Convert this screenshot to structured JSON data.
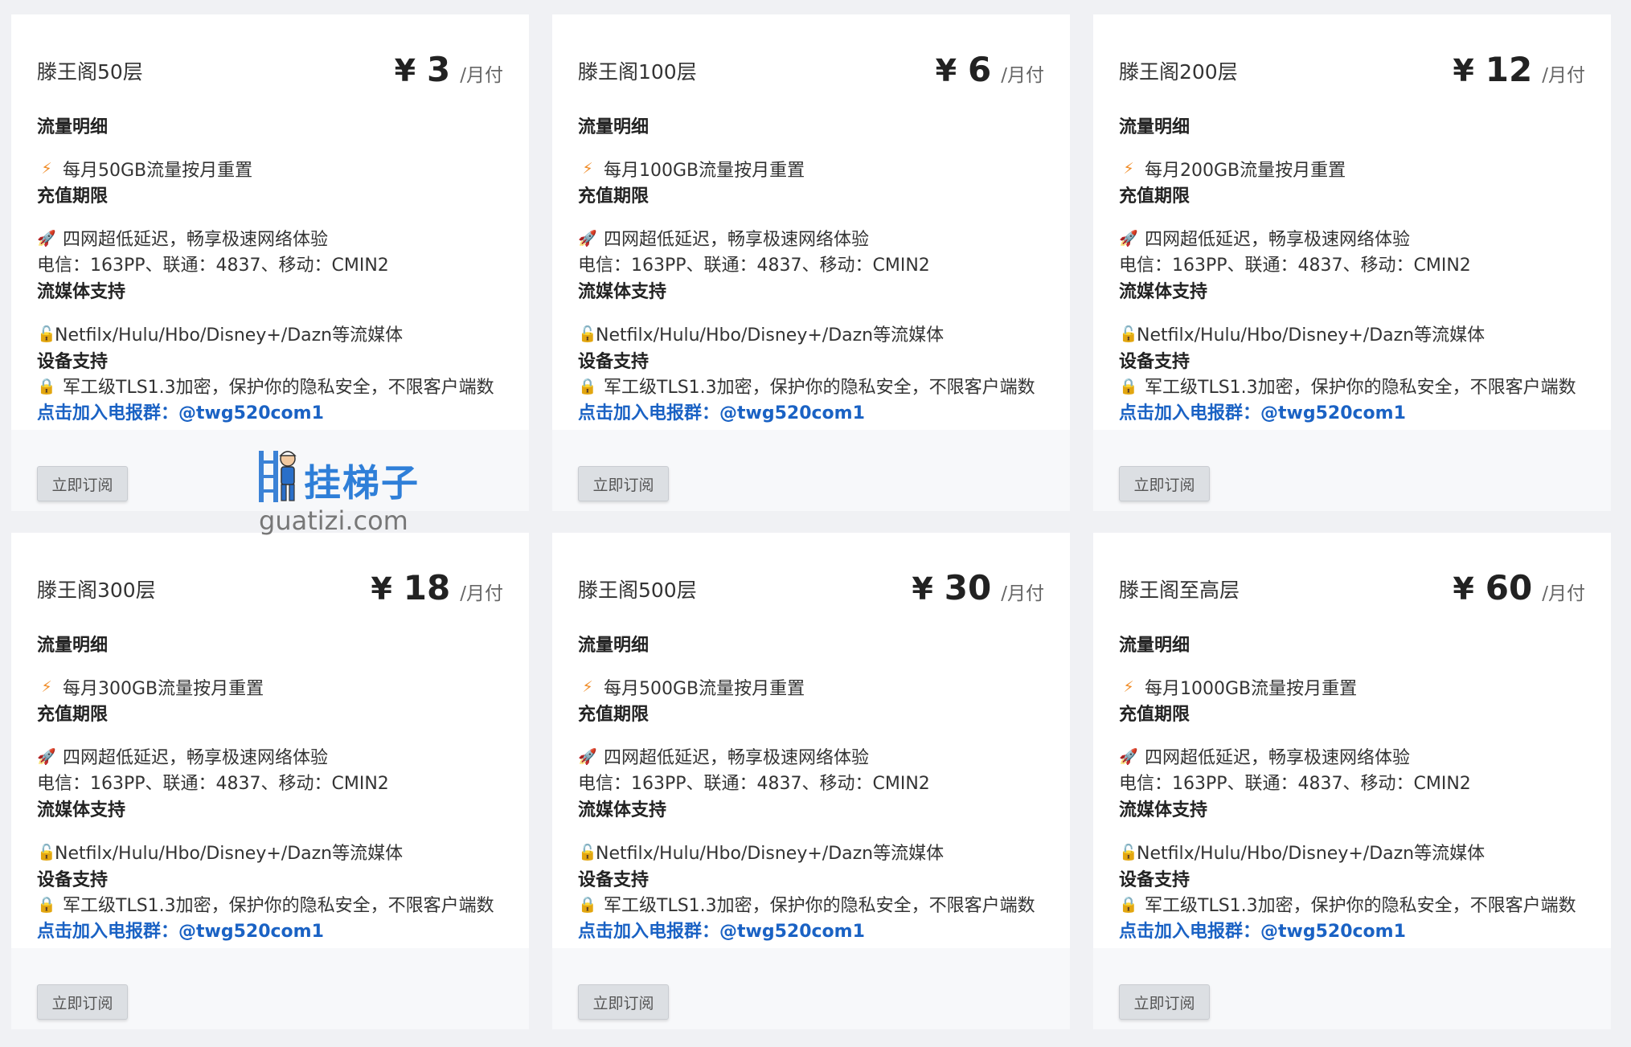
{
  "plans": [
    {
      "title": "滕王阁50层",
      "currency": "¥",
      "amount": "3",
      "period": "/月付",
      "traffic": "每月50GB流量按月重置"
    },
    {
      "title": "滕王阁100层",
      "currency": "¥",
      "amount": "6",
      "period": "/月付",
      "traffic": "每月100GB流量按月重置"
    },
    {
      "title": "滕王阁200层",
      "currency": "¥",
      "amount": "12",
      "period": "/月付",
      "traffic": "每月200GB流量按月重置"
    },
    {
      "title": "滕王阁300层",
      "currency": "¥",
      "amount": "18",
      "period": "/月付",
      "traffic": "每月300GB流量按月重置"
    },
    {
      "title": "滕王阁500层",
      "currency": "¥",
      "amount": "30",
      "period": "/月付",
      "traffic": "每月500GB流量按月重置"
    },
    {
      "title": "滕王阁至高层",
      "currency": "¥",
      "amount": "60",
      "period": "/月付",
      "traffic": "每月1000GB流量按月重置"
    }
  ],
  "common": {
    "sec_traffic": "流量明细",
    "sec_period": "充值期限",
    "network": "四网超低延迟，畅享极速网络体验",
    "carriers": "电信：163PP、联通：4837、移动：CMIN2",
    "sec_streaming": "流媒体支持",
    "streaming": "Netfilx/Hulu/Hbo/Disney+/Dazn等流媒体",
    "sec_device": "设备支持",
    "device": "军工级TLS1.3加密，保护你的隐私安全，不限客户端数",
    "tg_link": "点击加入电报群：@twg520com1",
    "subscribe": "立即订阅"
  },
  "icons": {
    "traffic": "lightning-icon",
    "network": "rocket-icon",
    "streaming": "unlock-icon",
    "device": "lock-icon"
  },
  "watermark": {
    "cn": "挂梯子",
    "en": "guatizi.com"
  },
  "colors": {
    "link": "#1a62c4",
    "button_bg": "#dcdfe3",
    "footer_bg": "#f7f8fa",
    "page_bg": "#f0f1f4",
    "watermark": "#2f7fd8"
  }
}
